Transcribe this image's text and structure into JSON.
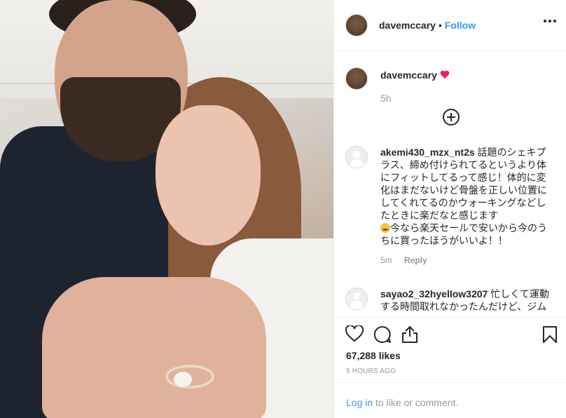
{
  "post": {
    "username": "davemccary",
    "follow_label": "Follow",
    "dot": "•",
    "caption_time": "5h",
    "likes": "67,288 likes",
    "timestamp": "5 HOURS AGO",
    "login_link": "Log in",
    "login_suffix": " to like or comment."
  },
  "comments": [
    {
      "username": "akemi430_mzx_nt2s",
      "text_a": " 話題のシェキプラス、締め付けられてるというより体にフィットしてるって感じ！体的に変化はまだないけど骨盤を正しい位置にしてくれてるのかウォーキングなどしたときに楽だなと感じます",
      "text_b": "今なら楽天セールで安いから今のうちに買ったほうがいいよ！！",
      "time": "5m",
      "reply_label": "Reply"
    },
    {
      "username": "sayao2_32hyellow3207",
      "text_a": " 忙しくて運動する時間取れなかったんだけど、ジム"
    }
  ],
  "colors": {
    "link": "#3897f0",
    "heart": "#e0245e",
    "text": "#262626",
    "muted": "#999999"
  },
  "icons": [
    "more-options-icon",
    "heart-icon",
    "comment-icon",
    "share-icon",
    "bookmark-icon",
    "load-more-icon"
  ]
}
